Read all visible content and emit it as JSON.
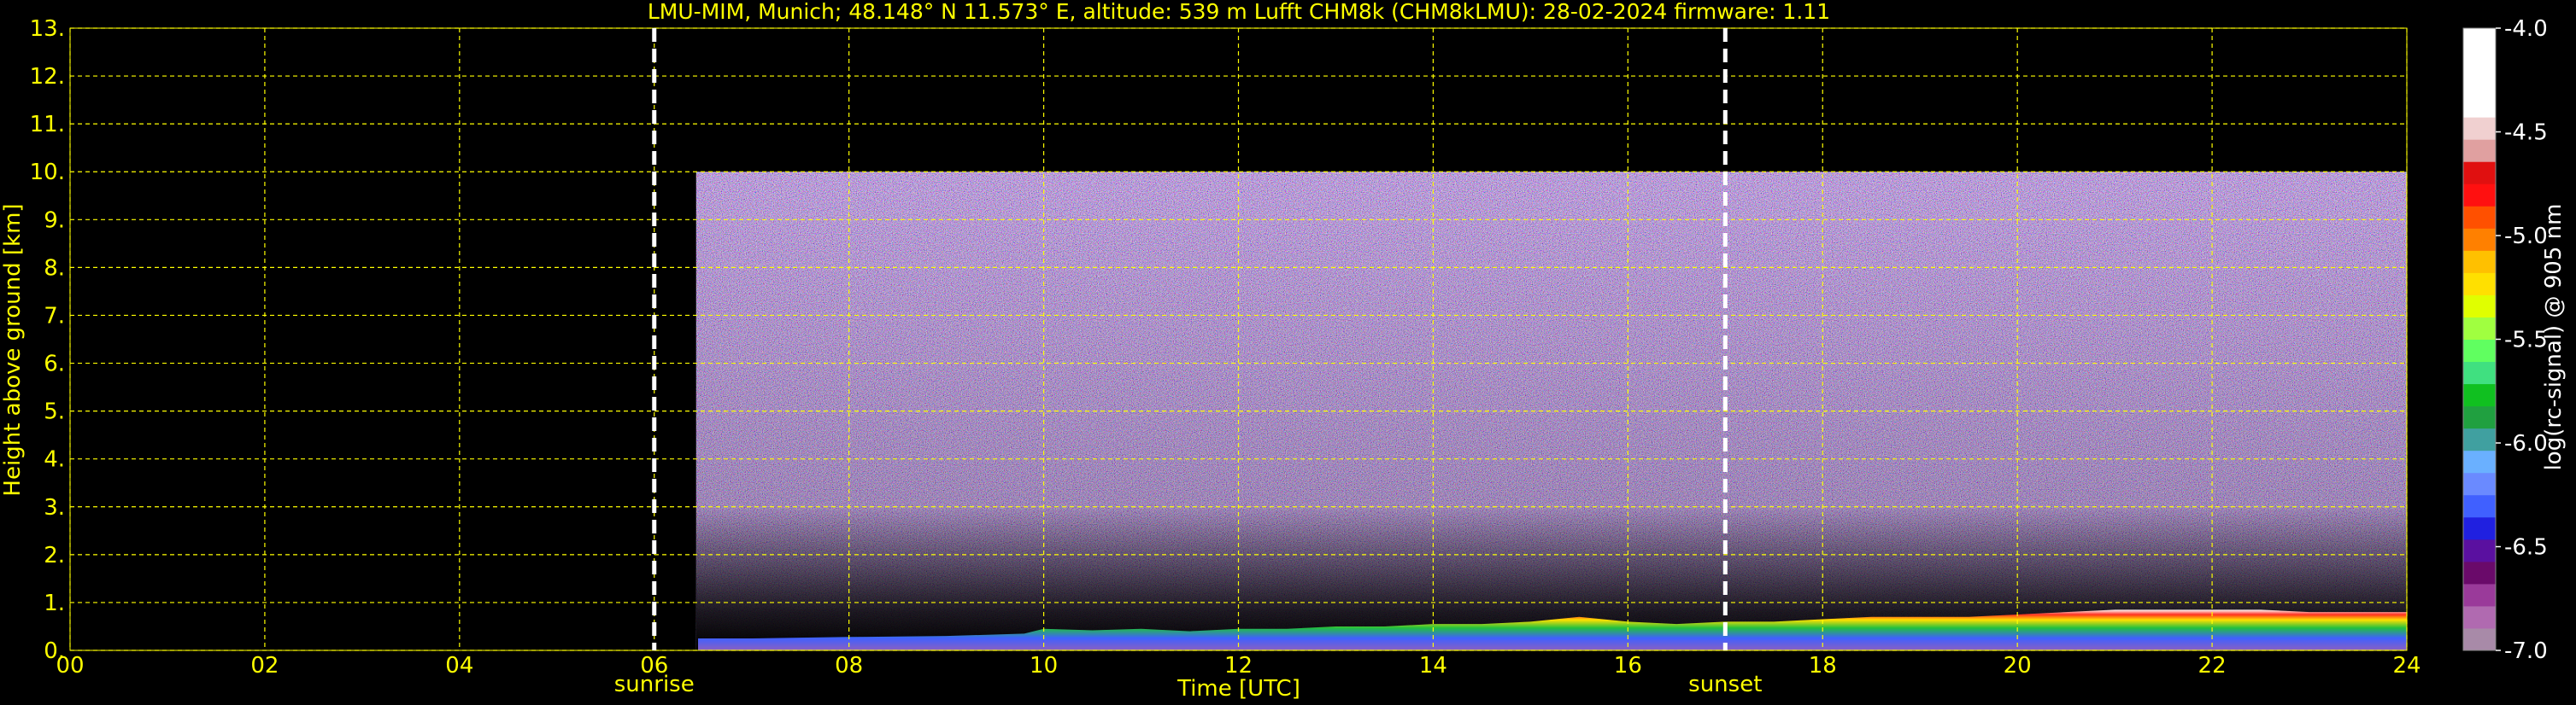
{
  "chart_data": {
    "type": "heatmap",
    "title": "LMU-MIM, Munich; 48.148° N 11.573° E, altitude: 539 m    Lufft CHM8k (CHM8kLMU): 28-02-2024    firmware: 1.11",
    "xlabel": "Time [UTC]",
    "ylabel": "Height above ground [km]",
    "xlim": [
      0,
      24
    ],
    "ylim": [
      0,
      13
    ],
    "x_ticks": [
      "00",
      "02",
      "04",
      "06",
      "08",
      "10",
      "12",
      "14",
      "16",
      "18",
      "20",
      "22",
      "24"
    ],
    "y_ticks": [
      "0.",
      "1.",
      "2.",
      "3.",
      "4.",
      "5.",
      "6.",
      "7.",
      "8.",
      "9.",
      "10.",
      "11.",
      "12.",
      "13."
    ],
    "grid": true,
    "grid_color": "#ffff00",
    "background_color": "#000000",
    "text_color": "#ffff00",
    "data_extent": {
      "time_start": 6.43,
      "time_end": 24,
      "height_max": 10
    },
    "markers": [
      {
        "label": "sunrise",
        "time": 6.0
      },
      {
        "label": "sunset",
        "time": 17.0
      }
    ],
    "boundary_layer": {
      "times": [
        6.45,
        7,
        8,
        9,
        9.8,
        10,
        10.5,
        11,
        11.5,
        12,
        12.5,
        13,
        13.5,
        14,
        14.5,
        15,
        15.5,
        16,
        16.5,
        17,
        17.5,
        18,
        18.5,
        19,
        19.5,
        20,
        20.5,
        21,
        21.5,
        22,
        22.5,
        23,
        23.5,
        24
      ],
      "heights_km": [
        0.25,
        0.25,
        0.28,
        0.3,
        0.35,
        0.45,
        0.42,
        0.45,
        0.4,
        0.45,
        0.45,
        0.5,
        0.5,
        0.55,
        0.55,
        0.6,
        0.7,
        0.6,
        0.55,
        0.6,
        0.6,
        0.65,
        0.7,
        0.7,
        0.7,
        0.75,
        0.8,
        0.85,
        0.85,
        0.85,
        0.85,
        0.8,
        0.8,
        0.8
      ]
    },
    "colorbar": {
      "label": "log(rc-signal) @ 905 nm",
      "range": [
        -7.0,
        -4.0
      ],
      "ticks": [
        "-4.0",
        "-4.5",
        "-5.0",
        "-5.5",
        "-6.0",
        "-6.5",
        "-7.0"
      ],
      "colors": [
        "#a88aa8",
        "#b06ab0",
        "#9a3a9a",
        "#6a0a6a",
        "#5a10a0",
        "#2020e0",
        "#4060ff",
        "#6a8aff",
        "#6ab0ff",
        "#40a0a0",
        "#20a040",
        "#10c020",
        "#40e080",
        "#60ff60",
        "#a0ff40",
        "#e0ff00",
        "#ffe000",
        "#ffc000",
        "#ff8000",
        "#ff5000",
        "#ff1010",
        "#e01010",
        "#e0a0a0",
        "#f0d0d0",
        "#ffffff",
        "#ffffff",
        "#ffffff",
        "#ffffff"
      ]
    }
  }
}
